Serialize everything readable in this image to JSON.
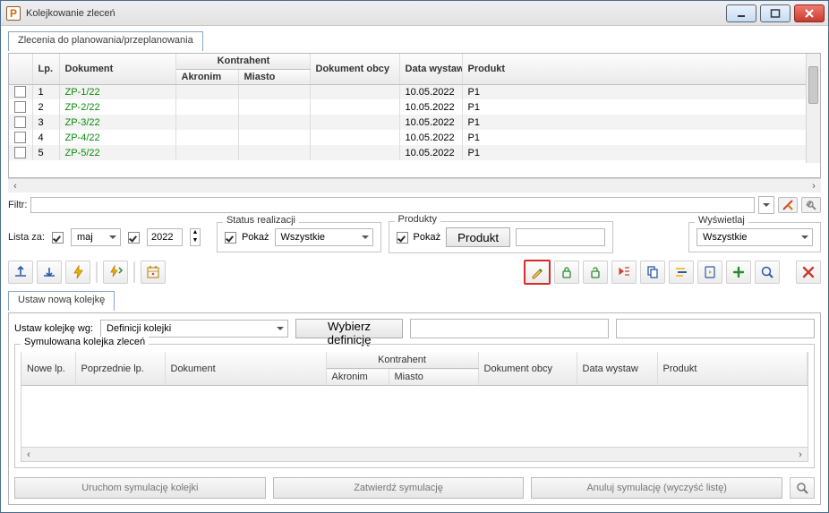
{
  "window": {
    "title": "Kolejkowanie zleceń"
  },
  "top_tab": "Zlecenia do planowania/przeplanowania",
  "grid": {
    "cols": {
      "lp": "Lp.",
      "dokument": "Dokument",
      "kontrahent": "Kontrahent",
      "akronim": "Akronim",
      "miasto": "Miasto",
      "dok_obcy": "Dokument obcy",
      "data_wystaw": "Data wystaw",
      "produkt": "Produkt"
    },
    "rows": [
      {
        "lp": "1",
        "dokument": "ZP-1/22",
        "akronim": "",
        "miasto": "",
        "dok_obcy": "",
        "data": "10.05.2022",
        "produkt": "P1"
      },
      {
        "lp": "2",
        "dokument": "ZP-2/22",
        "akronim": "",
        "miasto": "",
        "dok_obcy": "",
        "data": "10.05.2022",
        "produkt": "P1"
      },
      {
        "lp": "3",
        "dokument": "ZP-3/22",
        "akronim": "",
        "miasto": "",
        "dok_obcy": "",
        "data": "10.05.2022",
        "produkt": "P1"
      },
      {
        "lp": "4",
        "dokument": "ZP-4/22",
        "akronim": "",
        "miasto": "",
        "dok_obcy": "",
        "data": "10.05.2022",
        "produkt": "P1"
      },
      {
        "lp": "5",
        "dokument": "ZP-5/22",
        "akronim": "",
        "miasto": "",
        "dok_obcy": "",
        "data": "10.05.2022",
        "produkt": "P1"
      }
    ]
  },
  "filter": {
    "label": "Filtr:"
  },
  "list_for": {
    "label": "Lista za:",
    "month": "maj",
    "year": "2022"
  },
  "status": {
    "legend": "Status realizacji",
    "pokaz": "Pokaż",
    "value": "Wszystkie"
  },
  "products": {
    "legend": "Produkty",
    "pokaz": "Pokaż",
    "button": "Produkt"
  },
  "display": {
    "legend": "Wyświetlaj",
    "value": "Wszystkie"
  },
  "lower_tab": "Ustaw nową kolejkę",
  "def_row": {
    "label": "Ustaw kolejkę wg:",
    "select": "Definicji kolejki",
    "button": "Wybierz definicję"
  },
  "sim": {
    "legend": "Symulowana kolejka zleceń",
    "cols": {
      "nowe_lp": "Nowe lp.",
      "poprz_lp": "Poprzednie lp.",
      "dokument": "Dokument",
      "kontrahent": "Kontrahent",
      "akronim": "Akronim",
      "miasto": "Miasto",
      "dok_obcy": "Dokument obcy",
      "data_wystaw": "Data wystaw",
      "produkt": "Produkt"
    }
  },
  "actions": {
    "run": "Uruchom symulację kolejki",
    "approve": "Zatwierdź symulację",
    "cancel": "Anuluj symulację (wyczyść listę)"
  }
}
